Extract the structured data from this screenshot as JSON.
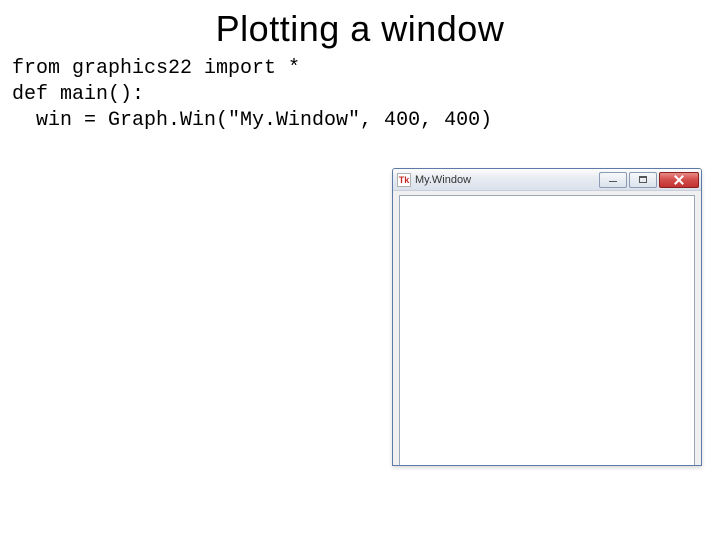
{
  "title": "Plotting a window",
  "code": {
    "line1": "from graphics22 import *",
    "line2": "def main():",
    "line3": "  win = Graph.Win(\"My.Window\", 400, 400)"
  },
  "window": {
    "icon_label": "Tk",
    "title": "My.Window"
  }
}
